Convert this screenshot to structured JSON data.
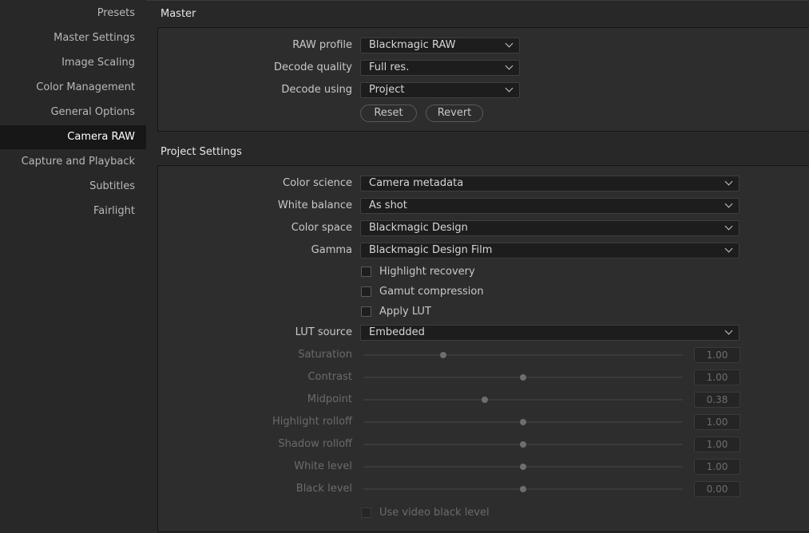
{
  "sidebar": {
    "items": [
      {
        "label": "Presets",
        "active": false
      },
      {
        "label": "Master Settings",
        "active": false
      },
      {
        "label": "Image Scaling",
        "active": false
      },
      {
        "label": "Color Management",
        "active": false
      },
      {
        "label": "General Options",
        "active": false
      },
      {
        "label": "Camera RAW",
        "active": true
      },
      {
        "label": "Capture and Playback",
        "active": false
      },
      {
        "label": "Subtitles",
        "active": false
      },
      {
        "label": "Fairlight",
        "active": false
      }
    ]
  },
  "master": {
    "title": "Master",
    "raw_profile": {
      "label": "RAW profile",
      "value": "Blackmagic RAW"
    },
    "decode_quality": {
      "label": "Decode quality",
      "value": "Full res."
    },
    "decode_using": {
      "label": "Decode using",
      "value": "Project"
    },
    "reset_label": "Reset",
    "revert_label": "Revert"
  },
  "project": {
    "title": "Project Settings",
    "color_science": {
      "label": "Color science",
      "value": "Camera metadata"
    },
    "white_balance": {
      "label": "White balance",
      "value": "As shot"
    },
    "color_space": {
      "label": "Color space",
      "value": "Blackmagic Design"
    },
    "gamma": {
      "label": "Gamma",
      "value": "Blackmagic Design Film"
    },
    "highlight_recovery": {
      "label": "Highlight recovery",
      "checked": false
    },
    "gamut_compression": {
      "label": "Gamut compression",
      "checked": false
    },
    "apply_lut": {
      "label": "Apply LUT",
      "checked": false
    },
    "lut_source": {
      "label": "LUT source",
      "value": "Embedded"
    },
    "sliders": [
      {
        "label": "Saturation",
        "value": "1.00",
        "fraction": 0.25
      },
      {
        "label": "Contrast",
        "value": "1.00",
        "fraction": 0.5
      },
      {
        "label": "Midpoint",
        "value": "0.38",
        "fraction": 0.38
      },
      {
        "label": "Highlight rolloff",
        "value": "1.00",
        "fraction": 0.5
      },
      {
        "label": "Shadow rolloff",
        "value": "1.00",
        "fraction": 0.5
      },
      {
        "label": "White level",
        "value": "1.00",
        "fraction": 0.5
      },
      {
        "label": "Black level",
        "value": "0.00",
        "fraction": 0.5
      }
    ],
    "use_video_black_level": {
      "label": "Use video black level",
      "checked": false
    }
  }
}
